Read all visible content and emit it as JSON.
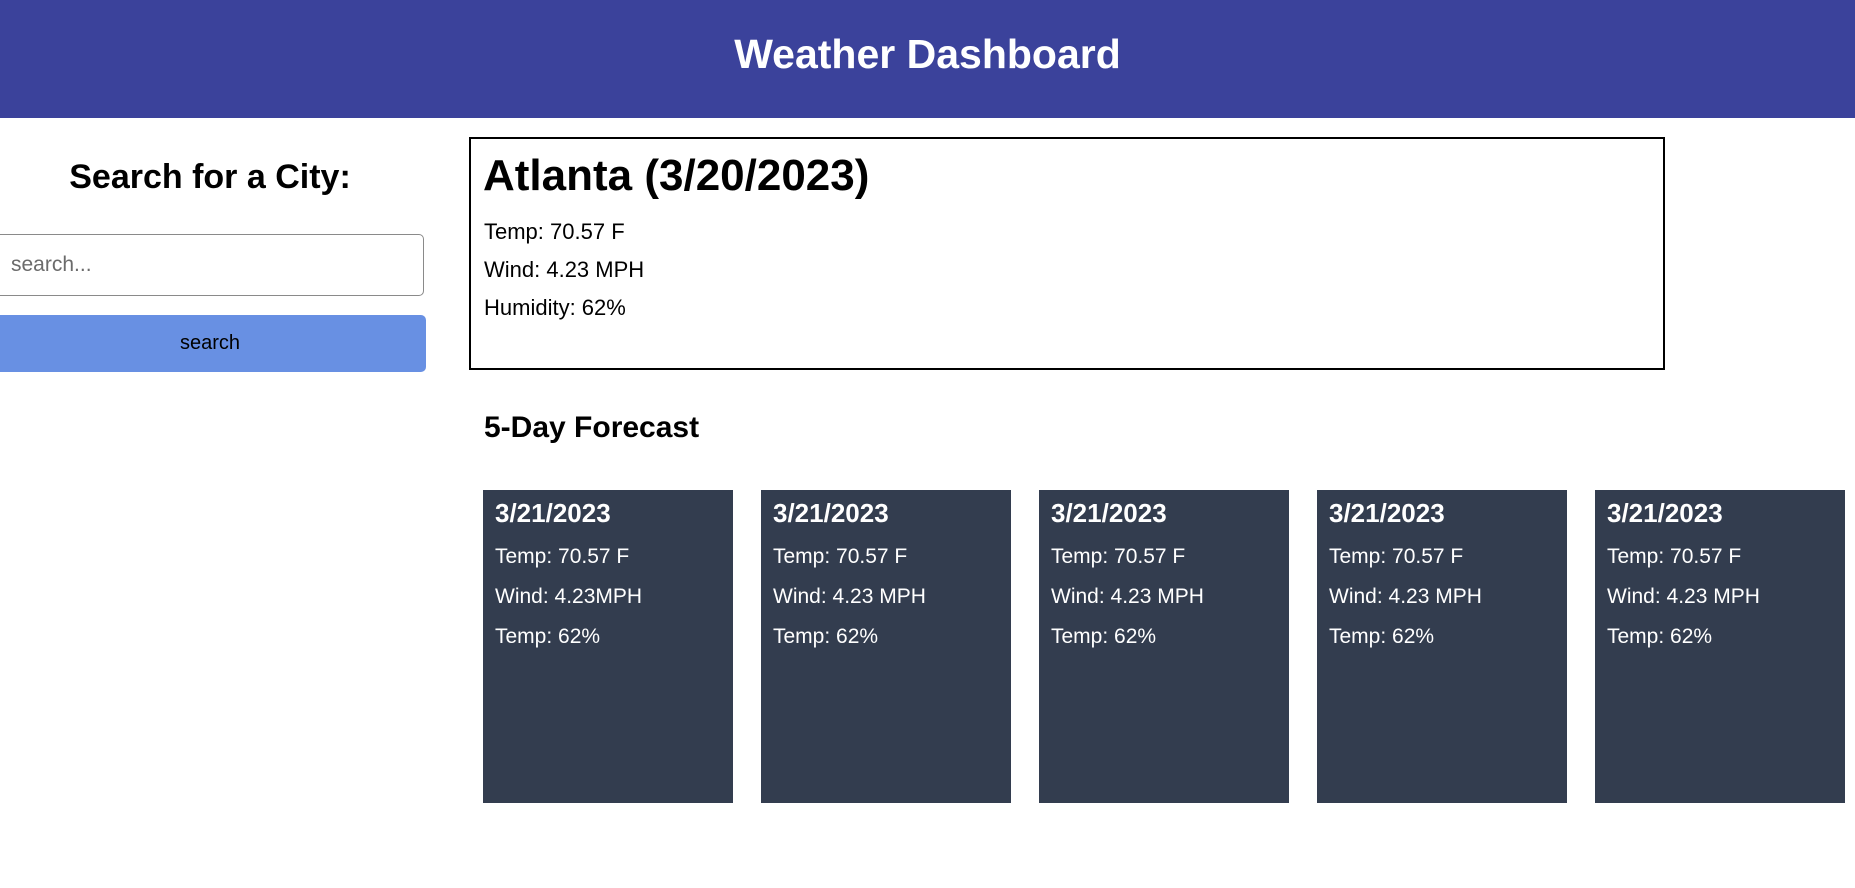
{
  "header": {
    "title": "Weather Dashboard"
  },
  "sidebar": {
    "heading": "Search for a City:",
    "search_placeholder": "search...",
    "search_button_label": "search"
  },
  "current": {
    "title": "Atlanta (3/20/2023)",
    "temp": "Temp: 70.57 F",
    "wind": "Wind: 4.23 MPH",
    "humidity": "Humidity: 62%"
  },
  "forecast": {
    "title": "5-Day Forecast",
    "days": [
      {
        "date": "3/21/2023",
        "temp": "Temp: 70.57 F",
        "wind": "Wind: 4.23MPH",
        "humidity": "Temp: 62%"
      },
      {
        "date": "3/21/2023",
        "temp": "Temp: 70.57 F",
        "wind": "Wind: 4.23 MPH",
        "humidity": "Temp: 62%"
      },
      {
        "date": "3/21/2023",
        "temp": "Temp: 70.57 F",
        "wind": "Wind: 4.23 MPH",
        "humidity": "Temp: 62%"
      },
      {
        "date": "3/21/2023",
        "temp": "Temp: 70.57 F",
        "wind": "Wind: 4.23 MPH",
        "humidity": "Temp: 62%"
      },
      {
        "date": "3/21/2023",
        "temp": "Temp: 70.57 F",
        "wind": "Wind: 4.23 MPH",
        "humidity": "Temp: 62%"
      }
    ]
  },
  "colors": {
    "header_bg": "#3b429b",
    "search_button_bg": "#6890e3",
    "card_bg": "#333d4f"
  }
}
